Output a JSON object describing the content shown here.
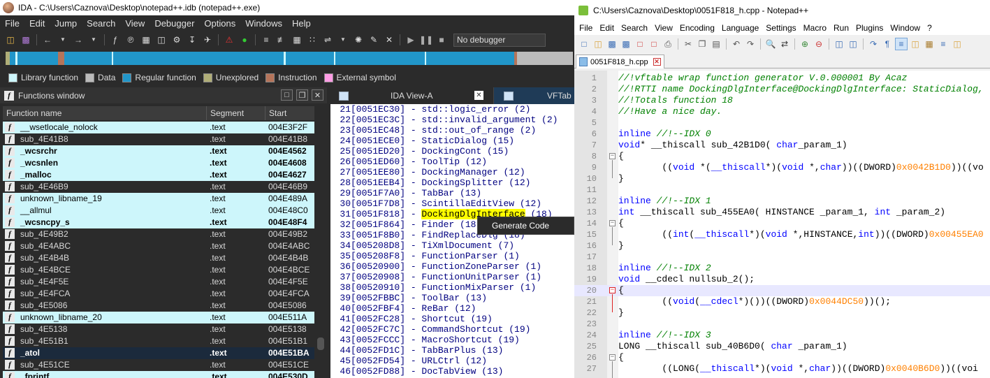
{
  "ida": {
    "title": "IDA - C:\\Users\\Caznova\\Desktop\\notepad++.idb (notepad++.exe)",
    "menu": [
      "File",
      "Edit",
      "Jump",
      "Search",
      "View",
      "Debugger",
      "Options",
      "Windows",
      "Help"
    ],
    "debugger_select": "No debugger",
    "legend": [
      {
        "label": "Library function",
        "color": "#cdf6fb"
      },
      {
        "label": "Data",
        "color": "#bbbbbb"
      },
      {
        "label": "Regular function",
        "color": "#2196c9"
      },
      {
        "label": "Unexplored",
        "color": "#b0ae78"
      },
      {
        "label": "Instruction",
        "color": "#b5745a"
      },
      {
        "label": "External symbol",
        "color": "#ff9de5"
      }
    ],
    "functions_window": {
      "title": "Functions window",
      "columns": [
        "Function name",
        "Segment",
        "Start"
      ],
      "rows": [
        {
          "name": "__wsetlocale_nolock",
          "segment": ".text",
          "start": "004E3F2F",
          "type": "lib",
          "bold": false
        },
        {
          "name": "sub_4E41B8",
          "segment": ".text",
          "start": "004E41B8",
          "type": "reg",
          "bold": false
        },
        {
          "name": "_wcsrchr",
          "segment": ".text",
          "start": "004E4562",
          "type": "lib",
          "bold": true
        },
        {
          "name": "_wcsnlen",
          "segment": ".text",
          "start": "004E4608",
          "type": "lib",
          "bold": true
        },
        {
          "name": "_malloc",
          "segment": ".text",
          "start": "004E4627",
          "type": "lib",
          "bold": true
        },
        {
          "name": "sub_4E46B9",
          "segment": ".text",
          "start": "004E46B9",
          "type": "reg",
          "bold": false
        },
        {
          "name": "unknown_libname_19",
          "segment": ".text",
          "start": "004E489A",
          "type": "lib",
          "bold": false
        },
        {
          "name": "__allmul",
          "segment": ".text",
          "start": "004E48C0",
          "type": "lib",
          "bold": false
        },
        {
          "name": "_wcsncpy_s",
          "segment": ".text",
          "start": "004E48F4",
          "type": "lib",
          "bold": true
        },
        {
          "name": "sub_4E49B2",
          "segment": ".text",
          "start": "004E49B2",
          "type": "reg",
          "bold": false
        },
        {
          "name": "sub_4E4ABC",
          "segment": ".text",
          "start": "004E4ABC",
          "type": "reg",
          "bold": false
        },
        {
          "name": "sub_4E4B4B",
          "segment": ".text",
          "start": "004E4B4B",
          "type": "reg",
          "bold": false
        },
        {
          "name": "sub_4E4BCE",
          "segment": ".text",
          "start": "004E4BCE",
          "type": "reg",
          "bold": false
        },
        {
          "name": "sub_4E4F5E",
          "segment": ".text",
          "start": "004E4F5E",
          "type": "reg",
          "bold": false
        },
        {
          "name": "sub_4E4FCA",
          "segment": ".text",
          "start": "004E4FCA",
          "type": "reg",
          "bold": false
        },
        {
          "name": "sub_4E5086",
          "segment": ".text",
          "start": "004E5086",
          "type": "reg",
          "bold": false
        },
        {
          "name": "unknown_libname_20",
          "segment": ".text",
          "start": "004E511A",
          "type": "lib",
          "bold": false
        },
        {
          "name": "sub_4E5138",
          "segment": ".text",
          "start": "004E5138",
          "type": "reg",
          "bold": false
        },
        {
          "name": "sub_4E51B1",
          "segment": ".text",
          "start": "004E51B1",
          "type": "reg",
          "bold": false
        },
        {
          "name": "_atol",
          "segment": ".text",
          "start": "004E51BA",
          "type": "lib",
          "bold": true
        },
        {
          "name": "sub_4E51CE",
          "segment": ".text",
          "start": "004E51CE",
          "type": "reg",
          "bold": false
        },
        {
          "name": "_fprintf",
          "segment": ".text",
          "start": "004E530D",
          "type": "lib",
          "bold": true
        }
      ]
    },
    "ida_view": {
      "tab_label": "IDA View-A",
      "second_tab_label": "VFTab",
      "lines": [
        {
          "n": "21",
          "addr": "[0051EC30]",
          "name": "std::logic_error (2)"
        },
        {
          "n": "22",
          "addr": "[0051EC3C]",
          "name": "std::invalid_argument (2)"
        },
        {
          "n": "23",
          "addr": "[0051EC48]",
          "name": "std::out_of_range (2)"
        },
        {
          "n": "24",
          "addr": "[0051ECE0]",
          "name": "StaticDialog (15)"
        },
        {
          "n": "25",
          "addr": "[0051ED20]",
          "name": "DockingCont (15)"
        },
        {
          "n": "26",
          "addr": "[0051ED60]",
          "name": "ToolTip (12)"
        },
        {
          "n": "27",
          "addr": "[0051EE80]",
          "name": "DockingManager (12)"
        },
        {
          "n": "28",
          "addr": "[0051EEB4]",
          "name": "DockingSplitter (12)"
        },
        {
          "n": "29",
          "addr": "[0051F7A0]",
          "name": "TabBar (13)"
        },
        {
          "n": "30",
          "addr": "[0051F7D8]",
          "name": "ScintillaEditView (12)"
        },
        {
          "n": "31",
          "addr": "[0051F818]",
          "name": "DockingDlgInterface (18)",
          "hl": "DockingDlgInterface"
        },
        {
          "n": "32",
          "addr": "[0051F864]",
          "name": "Finder (18)"
        },
        {
          "n": "33",
          "addr": "[0051F8B0]",
          "name": "FindReplaceDlg (18)"
        },
        {
          "n": "34",
          "addr": "[005208D8]",
          "name": "TiXmlDocument (7)"
        },
        {
          "n": "35",
          "addr": "[005208F8]",
          "name": "FunctionParser (1)"
        },
        {
          "n": "36",
          "addr": "[00520900]",
          "name": "FunctionZoneParser (1)"
        },
        {
          "n": "37",
          "addr": "[00520908]",
          "name": "FunctionUnitParser (1)"
        },
        {
          "n": "38",
          "addr": "[00520910]",
          "name": "FunctionMixParser (1)"
        },
        {
          "n": "39",
          "addr": "[0052FBBC]",
          "name": "ToolBar (13)"
        },
        {
          "n": "40",
          "addr": "[0052FBF4]",
          "name": "ReBar (12)"
        },
        {
          "n": "41",
          "addr": "[0052FC28]",
          "name": "Shortcut (19)"
        },
        {
          "n": "42",
          "addr": "[0052FC7C]",
          "name": "CommandShortcut (19)"
        },
        {
          "n": "43",
          "addr": "[0052FCCC]",
          "name": "MacroShortcut (19)"
        },
        {
          "n": "44",
          "addr": "[0052FD1C]",
          "name": "TabBarPlus (13)"
        },
        {
          "n": "45",
          "addr": "[0052FD54]",
          "name": "URLCtrl (12)"
        },
        {
          "n": "46",
          "addr": "[0052FD88]",
          "name": "DocTabView (13)"
        }
      ]
    },
    "context_menu": {
      "item": "Generate Code"
    }
  },
  "npp": {
    "title": "C:\\Users\\Caznova\\Desktop\\0051F818_h.cpp - Notepad++",
    "menu": [
      "File",
      "Edit",
      "Search",
      "View",
      "Encoding",
      "Language",
      "Settings",
      "Macro",
      "Run",
      "Plugins",
      "Window",
      "?"
    ],
    "tab_label": "0051F818_h.cpp",
    "lines": [
      {
        "n": "1",
        "parts": [
          [
            "cmt",
            "//!vftable wrap function generator V.0.000001 By Acaz"
          ]
        ]
      },
      {
        "n": "2",
        "parts": [
          [
            "cmt",
            "//!RTTI name DockingDlgInterface@DockingDlgInterface: StaticDialog,"
          ]
        ]
      },
      {
        "n": "3",
        "parts": [
          [
            "cmt",
            "//!Totals function 18"
          ]
        ]
      },
      {
        "n": "4",
        "parts": [
          [
            "cmt",
            "//!Have a nice day."
          ]
        ]
      },
      {
        "n": "5",
        "parts": []
      },
      {
        "n": "6",
        "parts": [
          [
            "kw",
            "inline "
          ],
          [
            "cmt",
            "//!--IDX 0"
          ]
        ]
      },
      {
        "n": "7",
        "parts": [
          [
            "kw",
            "void"
          ],
          [
            "",
            "* __thiscall sub_42B1D0( "
          ],
          [
            "kw",
            "char"
          ],
          [
            "",
            "_param_1)"
          ]
        ]
      },
      {
        "n": "8",
        "parts": [
          [
            "",
            "{"
          ]
        ],
        "fold": "open"
      },
      {
        "n": "9",
        "parts": [
          [
            "",
            "        (("
          ],
          [
            "kw",
            "void"
          ],
          [
            "",
            " *("
          ],
          [
            "kw",
            "__thiscall"
          ],
          [
            "",
            "*)("
          ],
          [
            "kw",
            "void"
          ],
          [
            "",
            " *,"
          ],
          [
            "kw",
            "char"
          ],
          [
            "",
            "))((DWORD)"
          ],
          [
            "hex",
            "0x0042B1D0"
          ],
          [
            "",
            "))((vo"
          ]
        ]
      },
      {
        "n": "10",
        "parts": [
          [
            "",
            "}"
          ]
        ]
      },
      {
        "n": "11",
        "parts": []
      },
      {
        "n": "12",
        "parts": [
          [
            "kw",
            "inline "
          ],
          [
            "cmt",
            "//!--IDX 1"
          ]
        ]
      },
      {
        "n": "13",
        "parts": [
          [
            "kw",
            "int"
          ],
          [
            "",
            " __thiscall sub_455EA0( HINSTANCE _param_1, "
          ],
          [
            "kw",
            "int"
          ],
          [
            "",
            " _param_2)"
          ]
        ]
      },
      {
        "n": "14",
        "parts": [
          [
            "",
            "{"
          ]
        ],
        "fold": "open"
      },
      {
        "n": "15",
        "parts": [
          [
            "",
            "        (("
          ],
          [
            "kw",
            "int"
          ],
          [
            "",
            "("
          ],
          [
            "kw",
            "__thiscall"
          ],
          [
            "",
            "*)("
          ],
          [
            "kw",
            "void"
          ],
          [
            "",
            " *,HINSTANCE,"
          ],
          [
            "kw",
            "int"
          ],
          [
            "",
            "))((DWORD)"
          ],
          [
            "hex",
            "0x00455EA0"
          ]
        ]
      },
      {
        "n": "16",
        "parts": [
          [
            "",
            "}"
          ]
        ]
      },
      {
        "n": "17",
        "parts": []
      },
      {
        "n": "18",
        "parts": [
          [
            "kw",
            "inline "
          ],
          [
            "cmt",
            "//!--IDX 2"
          ]
        ]
      },
      {
        "n": "19",
        "parts": [
          [
            "kw",
            "void"
          ],
          [
            "",
            " __cdecl nullsub_2();"
          ]
        ]
      },
      {
        "n": "20",
        "parts": [
          [
            "",
            "{"
          ]
        ],
        "fold": "red",
        "cur": true
      },
      {
        "n": "21",
        "parts": [
          [
            "",
            "        (("
          ],
          [
            "kw",
            "void"
          ],
          [
            "",
            "("
          ],
          [
            "kw",
            "__cdecl"
          ],
          [
            "",
            "*)())((DWORD)"
          ],
          [
            "hex",
            "0x0044DC50"
          ],
          [
            "",
            "))();"
          ]
        ]
      },
      {
        "n": "22",
        "parts": [
          [
            "",
            "}"
          ]
        ]
      },
      {
        "n": "23",
        "parts": []
      },
      {
        "n": "24",
        "parts": [
          [
            "kw",
            "inline "
          ],
          [
            "cmt",
            "//!--IDX 3"
          ]
        ]
      },
      {
        "n": "25",
        "parts": [
          [
            "",
            "LONG __thiscall sub_40B6D0( "
          ],
          [
            "kw",
            "char"
          ],
          [
            "",
            " _param_1)"
          ]
        ]
      },
      {
        "n": "26",
        "parts": [
          [
            "",
            "{"
          ]
        ],
        "fold": "open"
      },
      {
        "n": "27",
        "parts": [
          [
            "",
            "        ((LONG("
          ],
          [
            "kw",
            "__thiscall"
          ],
          [
            "",
            "*)("
          ],
          [
            "kw",
            "void"
          ],
          [
            "",
            " *,"
          ],
          [
            "kw",
            "char"
          ],
          [
            "",
            "))((DWORD)"
          ],
          [
            "hex",
            "0x0040B6D0"
          ],
          [
            "",
            "))((voi"
          ]
        ]
      }
    ]
  }
}
